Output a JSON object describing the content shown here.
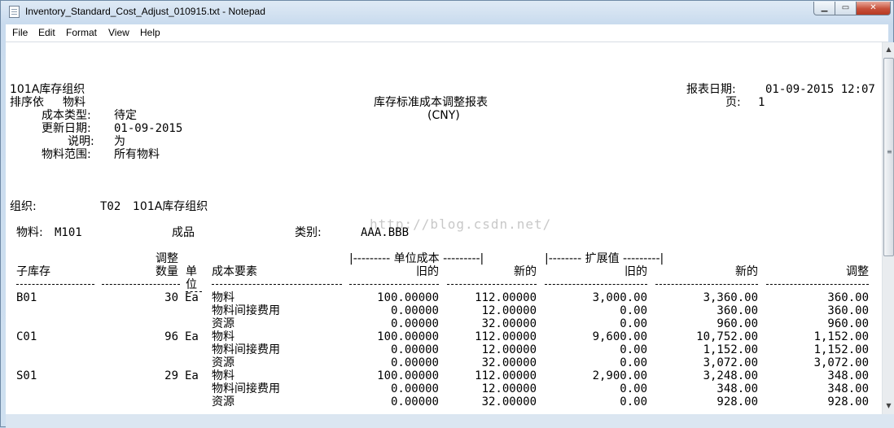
{
  "window": {
    "title": "Inventory_Standard_Cost_Adjust_010915.txt - Notepad",
    "min_label": "▁",
    "max_label": "▭",
    "close_label": "✕"
  },
  "menu": [
    "File",
    "Edit",
    "Format",
    "View",
    "Help"
  ],
  "scrollbar": {
    "up": "▲",
    "down": "▼",
    "grip": "≡"
  },
  "report": {
    "org_header": "101A库存组织",
    "sort_label": "排序依",
    "sort_value": "物料",
    "title": "库存标准成本调整报表",
    "currency": "(CNY)",
    "report_date_label": "报表日期:",
    "report_date_value": "01-09-2015 12:07",
    "page_label": "页:",
    "page_value": "1",
    "cost_type_label": "成本类型:",
    "cost_type_value": "待定",
    "update_date_label": "更新日期:",
    "update_date_value": "01-09-2015",
    "desc_label": "说明:",
    "desc_value": "为",
    "item_range_label": "物料范围:",
    "item_range_value": "所有物料",
    "org_label": "组织:",
    "org_code": "T02",
    "org_name": "101A库存组织",
    "item_label": "物料:",
    "item_value": "M101",
    "item_type": "成品",
    "category_label": "类别:",
    "category_value": "AAA.BBB",
    "watermark": "http://blog.csdn.net/"
  },
  "columns": {
    "group_unit_cost": "|--------- 单位成本 ---------|",
    "group_extended": "|-------- 扩展值 ---------|",
    "subinv": "子库存",
    "adj_line1": "调整",
    "adj_line2": "数量",
    "unit_line1": "单",
    "unit_line2": "位",
    "element": "成本要素",
    "old": "旧的",
    "new": "新的",
    "ext_old": "旧的",
    "ext_new": "新的",
    "adjust": "调整"
  },
  "rows": [
    {
      "subinv": "B01",
      "qty": "30",
      "uom": "Ea",
      "lines": [
        {
          "element": "物料",
          "old": "100.00000",
          "new": "112.00000",
          "ext_old": "3,000.00",
          "ext_new": "3,360.00",
          "adjust": "360.00"
        },
        {
          "element": "物料间接费用",
          "old": "0.00000",
          "new": "12.00000",
          "ext_old": "0.00",
          "ext_new": "360.00",
          "adjust": "360.00"
        },
        {
          "element": "资源",
          "old": "0.00000",
          "new": "32.00000",
          "ext_old": "0.00",
          "ext_new": "960.00",
          "adjust": "960.00"
        }
      ]
    },
    {
      "subinv": "C01",
      "qty": "96",
      "uom": "Ea",
      "lines": [
        {
          "element": "物料",
          "old": "100.00000",
          "new": "112.00000",
          "ext_old": "9,600.00",
          "ext_new": "10,752.00",
          "adjust": "1,152.00"
        },
        {
          "element": "物料间接费用",
          "old": "0.00000",
          "new": "12.00000",
          "ext_old": "0.00",
          "ext_new": "1,152.00",
          "adjust": "1,152.00"
        },
        {
          "element": "资源",
          "old": "0.00000",
          "new": "32.00000",
          "ext_old": "0.00",
          "ext_new": "3,072.00",
          "adjust": "3,072.00"
        }
      ]
    },
    {
      "subinv": "S01",
      "qty": "29",
      "uom": "Ea",
      "lines": [
        {
          "element": "物料",
          "old": "100.00000",
          "new": "112.00000",
          "ext_old": "2,900.00",
          "ext_new": "3,248.00",
          "adjust": "348.00"
        },
        {
          "element": "物料间接费用",
          "old": "0.00000",
          "new": "12.00000",
          "ext_old": "0.00",
          "ext_new": "348.00",
          "adjust": "348.00"
        },
        {
          "element": "资源",
          "old": "0.00000",
          "new": "32.00000",
          "ext_old": "0.00",
          "ext_new": "928.00",
          "adjust": "928.00"
        }
      ]
    }
  ]
}
